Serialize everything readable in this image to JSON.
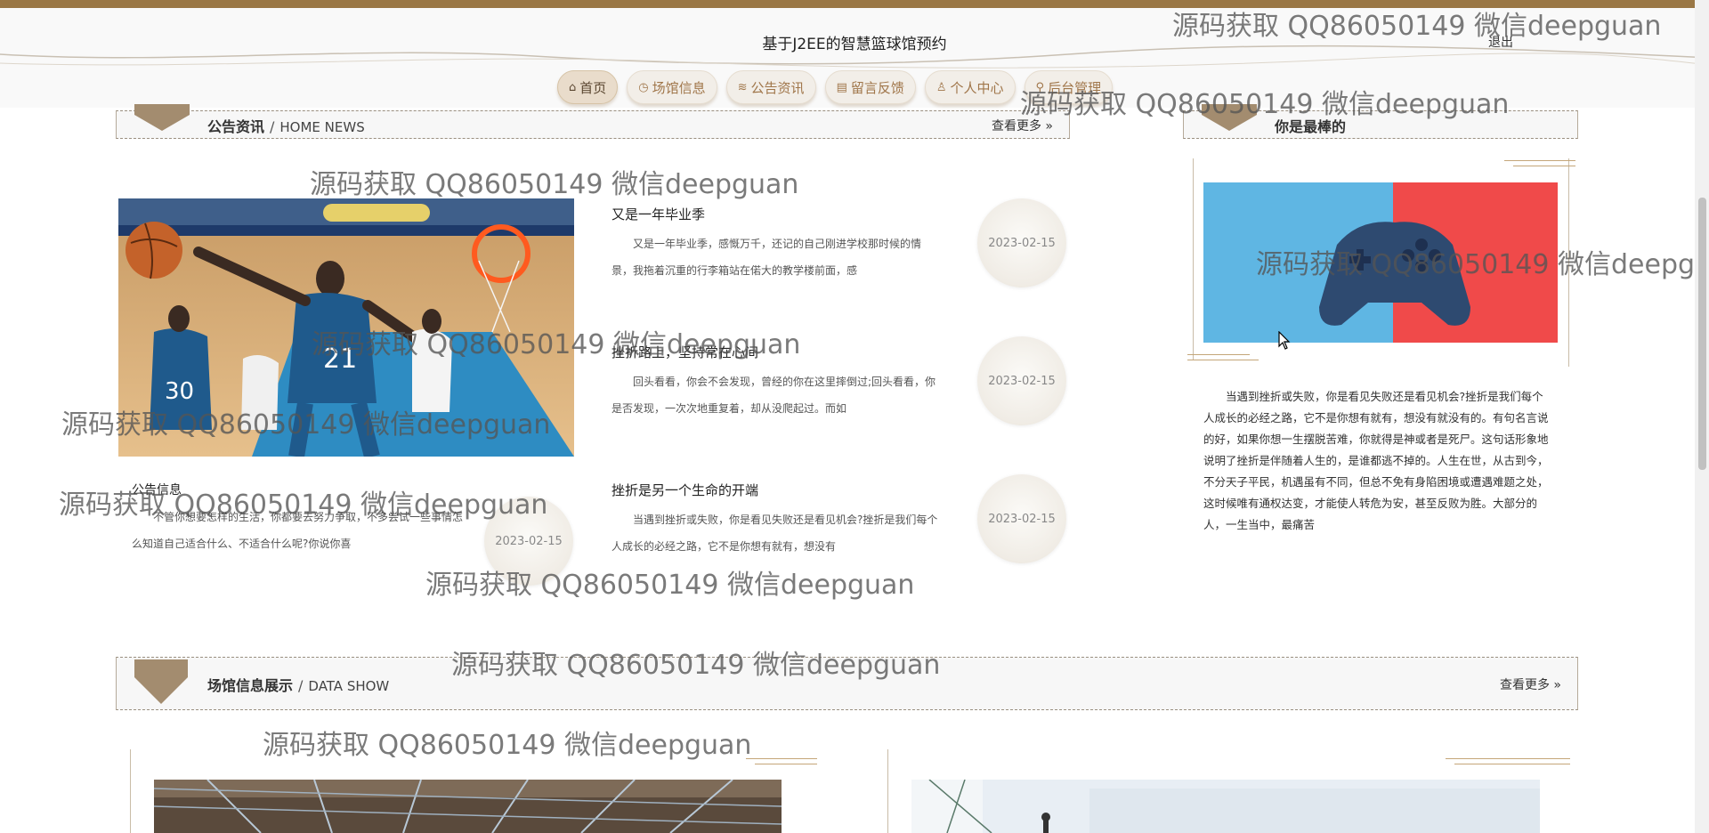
{
  "header": {
    "site_title": "基于J2EE的智慧篮球馆预约",
    "logout": "退出"
  },
  "nav": [
    {
      "label": "首页",
      "icon": "home-icon",
      "glyph": "⌂"
    },
    {
      "label": "场馆信息",
      "icon": "clock-icon",
      "glyph": "◷"
    },
    {
      "label": "公告资讯",
      "icon": "layers-icon",
      "glyph": "≋"
    },
    {
      "label": "留言反馈",
      "icon": "message-icon",
      "glyph": "▤"
    },
    {
      "label": "个人中心",
      "icon": "user-icon",
      "glyph": "♙"
    },
    {
      "label": "后台管理",
      "icon": "link-icon",
      "glyph": "⚲"
    }
  ],
  "news_section": {
    "title": "公告资讯",
    "separator": "/",
    "subtitle": "HOME NEWS",
    "more": "查看更多 »",
    "items": [
      {
        "title": "又是一年毕业季",
        "desc": "又是一年毕业季，感慨万千，还记的自己刚进学校那时候的情景，我拖着沉重的行李箱站在偌大的教学楼前面，感",
        "date": "2023-02-15"
      },
      {
        "title": "挫折路上，坚持常在心间",
        "desc": "回头看看，你会不会发现，曾经的你在这里摔倒过;回头看看，你是否发现，一次次地重复着，却从没爬起过。而如",
        "date": "2023-02-15"
      },
      {
        "title": "挫折是另一个生命的开端",
        "desc": "当遇到挫折或失败，你是看见失败还是看见机会?挫折是我们每个人成长的必经之路，它不是你想有就有，想没有",
        "date": "2023-02-15"
      }
    ],
    "left_item": {
      "title": "公告信息",
      "desc": "不管你想要怎样的生活，你都要去努力争取，不多尝试一些事情怎么知道自己适合什么、不适合什么呢?你说你喜",
      "date": "2023-02-15"
    }
  },
  "side_section": {
    "title": "你是最棒的",
    "text": "当遇到挫折或失败，你是看见失败还是看见机会?挫折是我们每个人成长的必经之路，它不是你想有就有，想没有就没有的。有句名言说的好，如果你想一生摆脱苦难，你就得是神或者是死尸。这句话形象地说明了挫折是伴随着人生的，是谁都逃不掉的。人生在世，从古到今，不分天子平民，机遇虽有不同，但总不免有身陷困境或遭遇难题之处，这时候唯有通权达变，才能使人转危为安，甚至反败为胜。大部分的人，一生当中，最痛苦"
  },
  "venue_section": {
    "title": "场馆信息展示",
    "separator": "/",
    "subtitle": "DATA SHOW",
    "more": "查看更多 »"
  },
  "watermark": "源码获取 QQ86050149 微信deepguan",
  "colors": {
    "brand_brown": "#9a7745",
    "nav_text": "#a0764a",
    "chevron": "#a38c6f",
    "controller_blue": "#5fb6e3",
    "controller_red": "#f04a4a"
  }
}
